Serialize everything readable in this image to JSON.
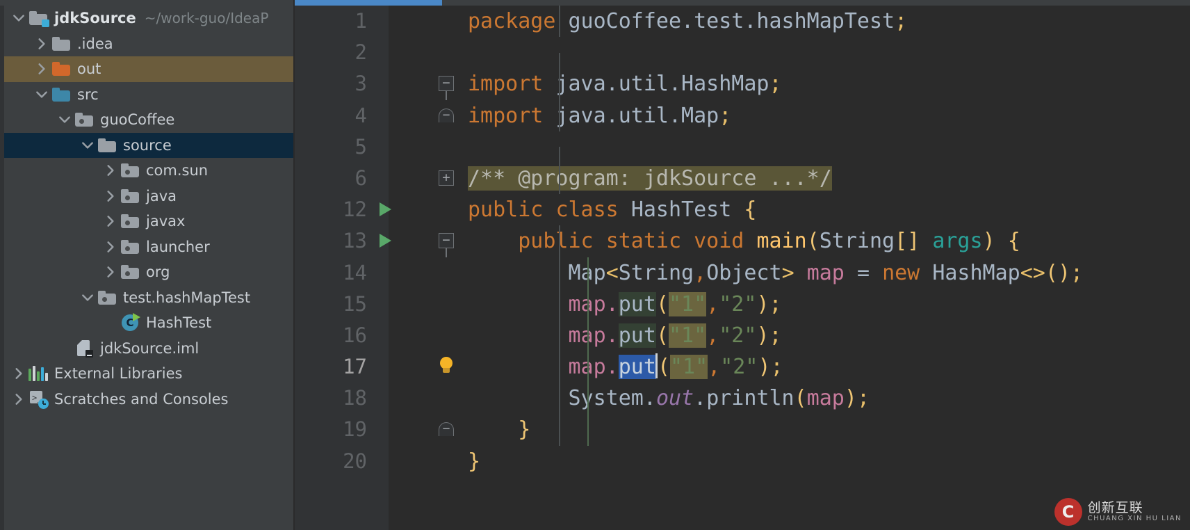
{
  "sidebar": {
    "name": "project-tool-window",
    "items": [
      {
        "label": "jdkSource",
        "hint": "~/work-guo/IdeaP",
        "icon": "folder-module-icon",
        "arrow": "chevron-down",
        "indent": 0,
        "bold": true,
        "state": "normal"
      },
      {
        "label": ".idea",
        "hint": "",
        "icon": "folder-grey-icon",
        "arrow": "chevron-right",
        "indent": 1,
        "bold": false,
        "state": "normal"
      },
      {
        "label": "out",
        "hint": "",
        "icon": "folder-orange-icon",
        "arrow": "chevron-right",
        "indent": 1,
        "bold": false,
        "state": "olive"
      },
      {
        "label": "src",
        "hint": "",
        "icon": "folder-blue-icon",
        "arrow": "chevron-down",
        "indent": 1,
        "bold": false,
        "state": "normal"
      },
      {
        "label": "guoCoffee",
        "hint": "",
        "icon": "package-icon",
        "arrow": "chevron-down",
        "indent": 2,
        "bold": false,
        "state": "normal"
      },
      {
        "label": "source",
        "hint": "",
        "icon": "folder-grey-icon",
        "arrow": "chevron-down",
        "indent": 3,
        "bold": false,
        "state": "selected"
      },
      {
        "label": "com.sun",
        "hint": "",
        "icon": "package-icon",
        "arrow": "chevron-right",
        "indent": 4,
        "bold": false,
        "state": "normal"
      },
      {
        "label": "java",
        "hint": "",
        "icon": "package-icon",
        "arrow": "chevron-right",
        "indent": 4,
        "bold": false,
        "state": "normal"
      },
      {
        "label": "javax",
        "hint": "",
        "icon": "package-icon",
        "arrow": "chevron-right",
        "indent": 4,
        "bold": false,
        "state": "normal"
      },
      {
        "label": "launcher",
        "hint": "",
        "icon": "package-icon",
        "arrow": "chevron-right",
        "indent": 4,
        "bold": false,
        "state": "normal"
      },
      {
        "label": "org",
        "hint": "",
        "icon": "package-icon",
        "arrow": "chevron-right",
        "indent": 4,
        "bold": false,
        "state": "normal"
      },
      {
        "label": "test.hashMapTest",
        "hint": "",
        "icon": "package-icon",
        "arrow": "chevron-down",
        "indent": 3,
        "bold": false,
        "state": "normal"
      },
      {
        "label": "HashTest",
        "hint": "",
        "icon": "java-class-runnable-icon",
        "arrow": "none",
        "indent": 4,
        "bold": false,
        "state": "normal"
      },
      {
        "label": "jdkSource.iml",
        "hint": "",
        "icon": "iml-file-icon",
        "arrow": "none",
        "indent": 2,
        "bold": false,
        "state": "normal"
      },
      {
        "label": "External Libraries",
        "hint": "",
        "icon": "external-libraries-icon",
        "arrow": "chevron-right",
        "indent": 0,
        "bold": false,
        "state": "normal"
      },
      {
        "label": "Scratches and Consoles",
        "hint": "",
        "icon": "scratches-icon",
        "arrow": "chevron-right",
        "indent": 0,
        "bold": false,
        "state": "normal"
      }
    ]
  },
  "editor": {
    "name": "code-editor",
    "active_tab_accent": "#4a88c7",
    "background": "#2b2b2b",
    "gutter_background": "#313335",
    "lines": [
      {
        "num": "1",
        "gutter": "none",
        "current": false
      },
      {
        "num": "2",
        "gutter": "none",
        "current": false
      },
      {
        "num": "3",
        "gutter": "fold-top",
        "current": false
      },
      {
        "num": "4",
        "gutter": "fold-end",
        "current": false
      },
      {
        "num": "5",
        "gutter": "none",
        "current": false
      },
      {
        "num": "6",
        "gutter": "fold-plus",
        "current": false
      },
      {
        "num": "12",
        "gutter": "run",
        "current": false
      },
      {
        "num": "13",
        "gutter": "run-fold",
        "current": false
      },
      {
        "num": "14",
        "gutter": "none",
        "current": false
      },
      {
        "num": "15",
        "gutter": "none",
        "current": false
      },
      {
        "num": "16",
        "gutter": "none",
        "current": false
      },
      {
        "num": "17",
        "gutter": "bulb",
        "current": true
      },
      {
        "num": "18",
        "gutter": "none",
        "current": false
      },
      {
        "num": "19",
        "gutter": "fold-end",
        "current": false
      },
      {
        "num": "20",
        "gutter": "none",
        "current": false
      }
    ],
    "code": {
      "l1": "package guoCoffee.test.hashMapTest;",
      "l3": "import java.util.HashMap;",
      "l4": "import java.util.Map;",
      "l6": "/** @program: jdkSource ...*/",
      "l12": "public class HashTest {",
      "l13": "public static void main(String[] args) {",
      "l14": "Map<String,Object> map = new HashMap<>();",
      "l15": "map.put(\"1\",\"2\");",
      "l16": "map.put(\"1\",\"2\");",
      "l17": "map.put(\"1\",\"2\");",
      "l18": "System.out.println(map);",
      "l19": "}",
      "l20": "}"
    },
    "tokens": {
      "kw_package": "package",
      "kw_import": "import",
      "kw_public": "public",
      "kw_class": "class",
      "kw_static": "static",
      "kw_void": "void",
      "kw_new": "new",
      "pkg_name": "guoCoffee.test.hashMapTest",
      "imp_hashmap": "java.util.HashMap",
      "imp_map": "java.util.Map",
      "comment_fold": "/** @program: jdkSource ...*/",
      "class_name": "HashTest",
      "method_main": "main",
      "type_string": "String",
      "param_args": "args",
      "type_map": "Map",
      "generic_string": "String",
      "generic_object": "Object",
      "var_map": "map",
      "type_hashmap": "HashMap",
      "method_put": "put",
      "str_1": "\"1\"",
      "str_2": "\"2\"",
      "sys": "System",
      "field_out": "out",
      "method_println": "println",
      "semicolon": ";",
      "brace_open": "{",
      "brace_close": "}",
      "paren_open": "(",
      "paren_close": ")",
      "bracket_pair": "[]",
      "angle_open": "<",
      "angle_close": ">",
      "angle_diamond": "<>",
      "comma": ",",
      "dot": ".",
      "equals": "=",
      "fold_plus": "+",
      "fold_minus": "−"
    },
    "highlights": {
      "fold_bg": "#5a5637",
      "usage_bg": "#344134",
      "string_bg": "#6b653f",
      "selection_bg": "#2c5aa8"
    }
  },
  "watermark": {
    "logo_letter": "C",
    "cn": "创新互联",
    "en": "CHUANG XIN HU LIAN"
  }
}
